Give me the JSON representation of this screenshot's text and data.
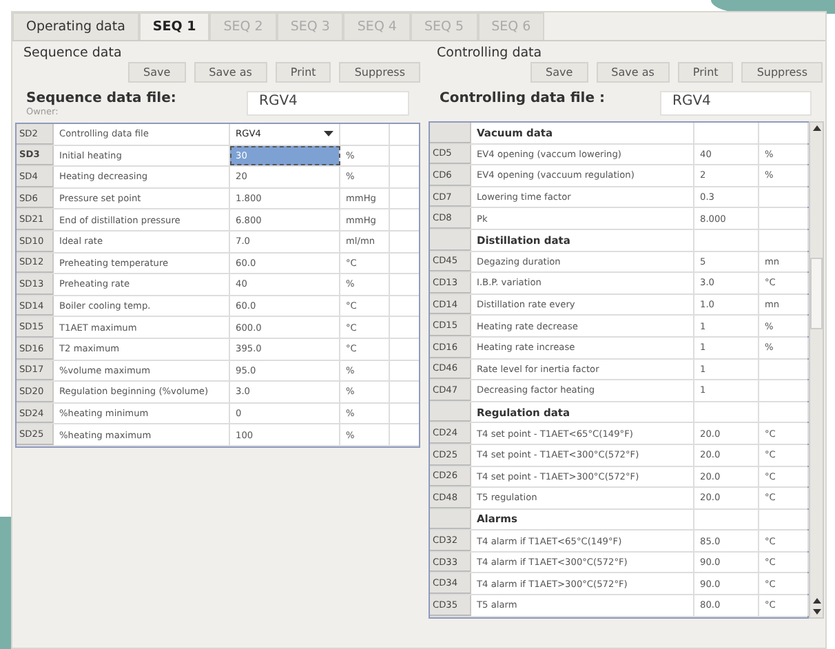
{
  "tabs": [
    {
      "label": "Operating data",
      "selected": false,
      "disabled": false
    },
    {
      "label": "SEQ 1",
      "selected": true,
      "disabled": false
    },
    {
      "label": "SEQ 2",
      "selected": false,
      "disabled": true
    },
    {
      "label": "SEQ 3",
      "selected": false,
      "disabled": true
    },
    {
      "label": "SEQ 4",
      "selected": false,
      "disabled": true
    },
    {
      "label": "SEQ 5",
      "selected": false,
      "disabled": true
    },
    {
      "label": "SEQ 6",
      "selected": false,
      "disabled": true
    }
  ],
  "sequence": {
    "title": "Sequence data",
    "buttons": [
      "Save",
      "Save as",
      "Print",
      "Suppress"
    ],
    "file_label": "Sequence data file:",
    "owner_label": "Owner:",
    "file_value": "RGV4",
    "rows": [
      {
        "code": "SD2",
        "name": "Controlling data file",
        "value": "RGV4",
        "unit": "",
        "kind": "dropdown",
        "selected": false
      },
      {
        "code": "SD3",
        "name": "Initial heating",
        "value": "30",
        "unit": "%",
        "kind": "value",
        "selected": true
      },
      {
        "code": "SD4",
        "name": "Heating decreasing",
        "value": "20",
        "unit": "%",
        "kind": "value",
        "selected": false
      },
      {
        "code": "SD6",
        "name": "Pressure set point",
        "value": "1.800",
        "unit": "mmHg",
        "kind": "value",
        "selected": false
      },
      {
        "code": "SD21",
        "name": "End of distillation pressure",
        "value": "6.800",
        "unit": "mmHg",
        "kind": "value",
        "selected": false
      },
      {
        "code": "SD10",
        "name": "Ideal rate",
        "value": "7.0",
        "unit": "ml/mn",
        "kind": "value",
        "selected": false
      },
      {
        "code": "SD12",
        "name": "Preheating temperature",
        "value": "60.0",
        "unit": "°C",
        "kind": "value",
        "selected": false
      },
      {
        "code": "SD13",
        "name": "Preheating rate",
        "value": "40",
        "unit": "%",
        "kind": "value",
        "selected": false
      },
      {
        "code": "SD14",
        "name": "Boiler cooling temp.",
        "value": "60.0",
        "unit": "°C",
        "kind": "value",
        "selected": false
      },
      {
        "code": "SD15",
        "name": "T1AET maximum",
        "value": "600.0",
        "unit": "°C",
        "kind": "value",
        "selected": false
      },
      {
        "code": "SD16",
        "name": "T2 maximum",
        "value": "395.0",
        "unit": "°C",
        "kind": "value",
        "selected": false
      },
      {
        "code": "SD17",
        "name": "%volume maximum",
        "value": "95.0",
        "unit": "%",
        "kind": "value",
        "selected": false
      },
      {
        "code": "SD20",
        "name": "Regulation beginning (%volume)",
        "value": "3.0",
        "unit": "%",
        "kind": "value",
        "selected": false
      },
      {
        "code": "SD24",
        "name": "%heating minimum",
        "value": "0",
        "unit": "%",
        "kind": "value",
        "selected": false
      },
      {
        "code": "SD25",
        "name": "%heating maximum",
        "value": "100",
        "unit": "%",
        "kind": "value",
        "selected": false
      }
    ]
  },
  "controlling": {
    "title": "Controlling data",
    "buttons": [
      "Save",
      "Save as",
      "Print",
      "Suppress"
    ],
    "file_label": "Controlling data file :",
    "file_value": "RGV4",
    "rows": [
      {
        "kind": "section",
        "name": "Vacuum data"
      },
      {
        "kind": "param",
        "code": "CD5",
        "name": "EV4 opening (vaccum lowering)",
        "value": "40",
        "unit": "%"
      },
      {
        "kind": "param",
        "code": "CD6",
        "name": "EV4 opening (vaccuum regulation)",
        "value": "2",
        "unit": "%"
      },
      {
        "kind": "param",
        "code": "CD7",
        "name": "Lowering time factor",
        "value": "0.3",
        "unit": ""
      },
      {
        "kind": "param",
        "code": "CD8",
        "name": "Pk",
        "value": "8.000",
        "unit": ""
      },
      {
        "kind": "section",
        "name": "Distillation data"
      },
      {
        "kind": "param",
        "code": "CD45",
        "name": "Degazing duration",
        "value": "5",
        "unit": "mn"
      },
      {
        "kind": "param",
        "code": "CD13",
        "name": "I.B.P. variation",
        "value": "3.0",
        "unit": "°C"
      },
      {
        "kind": "param",
        "code": "CD14",
        "name": "Distillation rate every",
        "value": "1.0",
        "unit": "mn"
      },
      {
        "kind": "param",
        "code": "CD15",
        "name": "Heating rate decrease",
        "value": "1",
        "unit": "%"
      },
      {
        "kind": "param",
        "code": "CD16",
        "name": "Heating rate increase",
        "value": "1",
        "unit": "%"
      },
      {
        "kind": "param",
        "code": "CD46",
        "name": "Rate level for inertia factor",
        "value": "1",
        "unit": ""
      },
      {
        "kind": "param",
        "code": "CD47",
        "name": "Decreasing factor heating",
        "value": "1",
        "unit": ""
      },
      {
        "kind": "section",
        "name": "Regulation data"
      },
      {
        "kind": "param",
        "code": "CD24",
        "name": "T4 set point - T1AET<65°C(149°F)",
        "value": "20.0",
        "unit": "°C"
      },
      {
        "kind": "param",
        "code": "CD25",
        "name": "T4 set point - T1AET<300°C(572°F)",
        "value": "20.0",
        "unit": "°C"
      },
      {
        "kind": "param",
        "code": "CD26",
        "name": "T4 set point - T1AET>300°C(572°F)",
        "value": "20.0",
        "unit": "°C"
      },
      {
        "kind": "param",
        "code": "CD48",
        "name": "T5 regulation",
        "value": "20.0",
        "unit": "°C"
      },
      {
        "kind": "section",
        "name": "Alarms"
      },
      {
        "kind": "param",
        "code": "CD32",
        "name": "T4 alarm if T1AET<65°C(149°F)",
        "value": "85.0",
        "unit": "°C"
      },
      {
        "kind": "param",
        "code": "CD33",
        "name": "T4 alarm if T1AET<300°C(572°F)",
        "value": "90.0",
        "unit": "°C"
      },
      {
        "kind": "param",
        "code": "CD34",
        "name": "T4 alarm if T1AET>300°C(572°F)",
        "value": "90.0",
        "unit": "°C"
      },
      {
        "kind": "param",
        "code": "CD35",
        "name": "T5 alarm",
        "value": "80.0",
        "unit": "°C"
      }
    ]
  }
}
